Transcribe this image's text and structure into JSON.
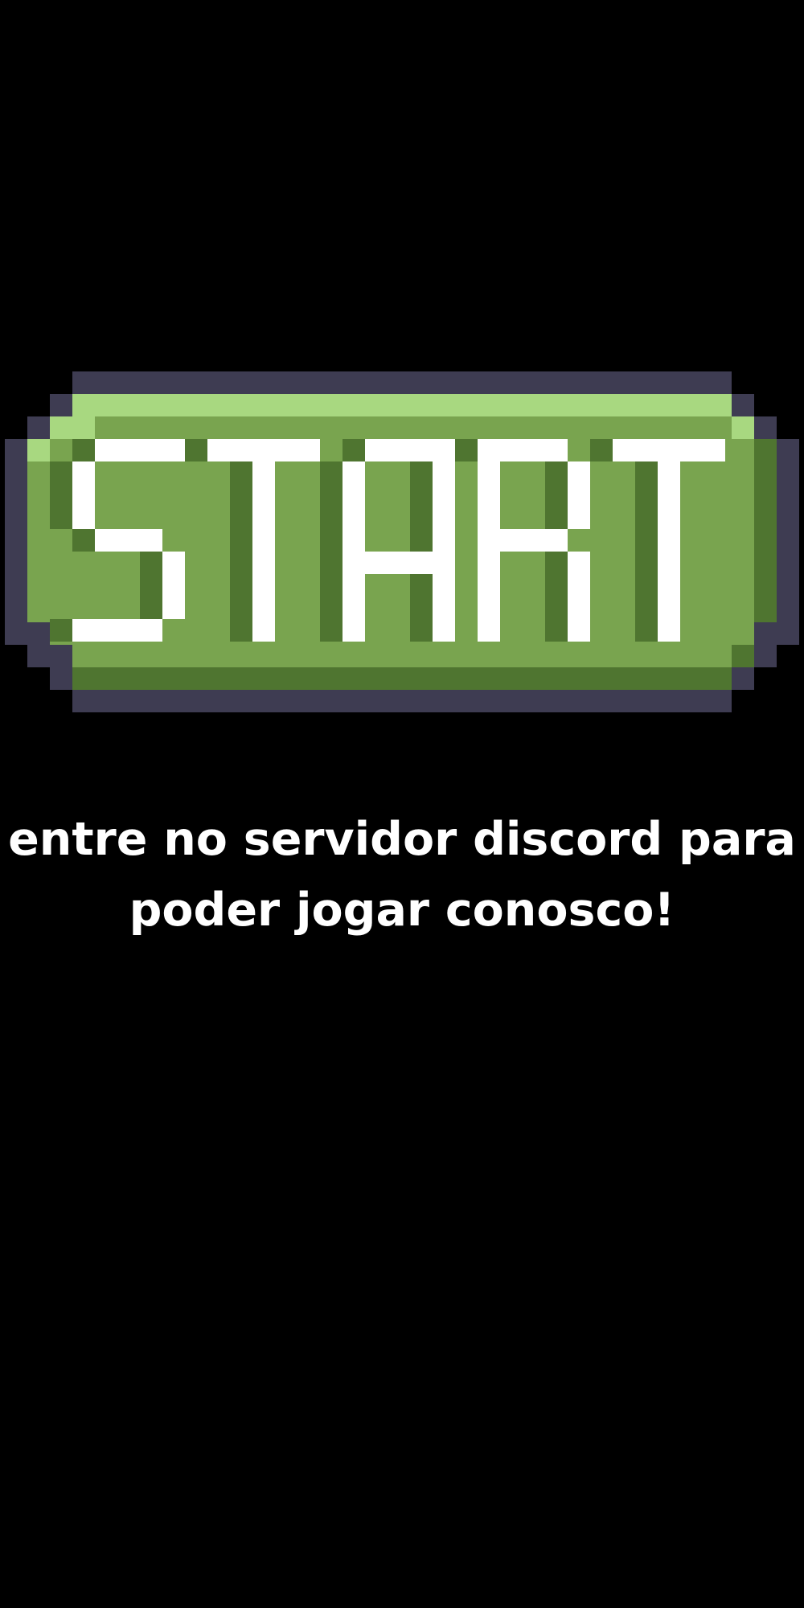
{
  "start_button": {
    "label": "START"
  },
  "message": {
    "line1": "entre no servidor discord para",
    "line2": "poder jogar conosco!"
  },
  "colors": {
    "background": "#000000",
    "button_outline": "#3e3c52",
    "button_highlight": "#a8d880",
    "button_body": "#79a44f",
    "button_shadow": "#4f7530",
    "button_text": "#ffffff",
    "message_text": "#ffffff"
  }
}
